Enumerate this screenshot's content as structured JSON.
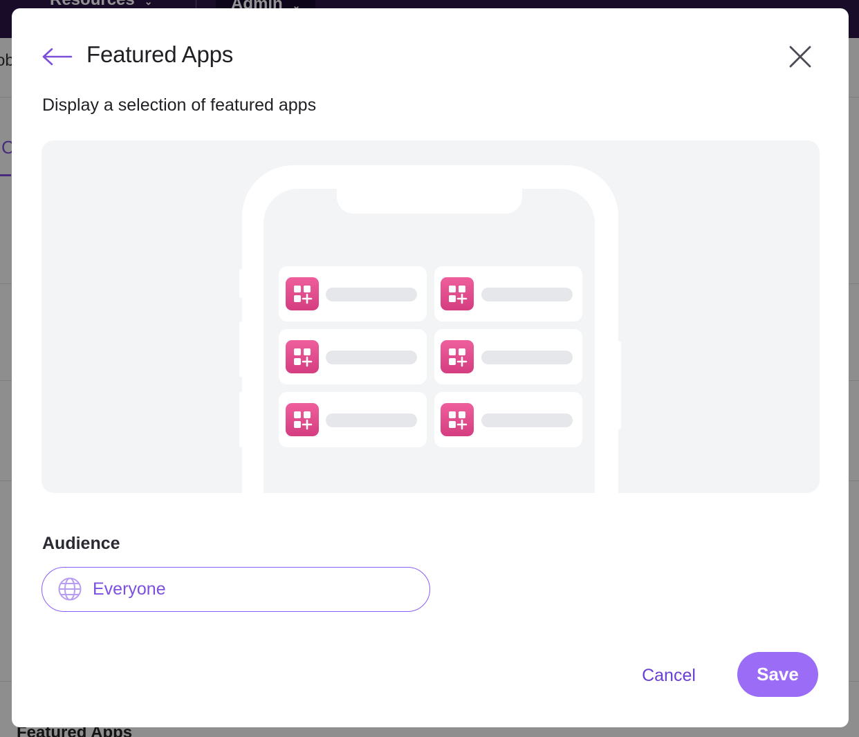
{
  "background": {
    "nav": {
      "resources": "Resources",
      "admin": "Admin"
    },
    "side_text": "ob",
    "tab_text": "C",
    "footer_title": "Featured Apps"
  },
  "modal": {
    "title": "Featured Apps",
    "description": "Display a selection of featured apps",
    "back_icon": "arrow-left-icon",
    "close_icon": "close-icon",
    "preview": {
      "device": "phone",
      "app_tiles": 6,
      "tile_icon": "app-grid-plus-icon"
    },
    "audience": {
      "label": "Audience",
      "value": "Everyone",
      "icon": "globe-icon"
    },
    "buttons": {
      "cancel": "Cancel",
      "save": "Save"
    }
  },
  "colors": {
    "accent": "#8b5cf6",
    "save_bg": "#9b6cf5",
    "tile_icon_bg": "#e4508f",
    "topbar": "#2a1547"
  }
}
